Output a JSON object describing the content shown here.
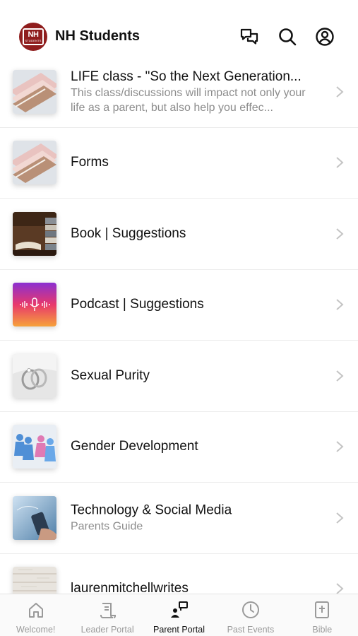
{
  "header": {
    "logo_text": "NH",
    "logo_sub": "STUDENTS",
    "title": "NH Students",
    "icons": [
      "messages-icon",
      "search-icon",
      "account-icon"
    ]
  },
  "items": [
    {
      "title": "LIFE class - \"So the Next Generation...",
      "subtitle": "This class/discussions will impact not only your life as a parent, but also help you effec...",
      "thumb": "notebooks-pink"
    },
    {
      "title": "Forms",
      "subtitle": "",
      "thumb": "notebooks-pink"
    },
    {
      "title": "Book | Suggestions",
      "subtitle": "",
      "thumb": "books-stack"
    },
    {
      "title": "Podcast | Suggestions",
      "subtitle": "",
      "thumb": "podcast-gradient"
    },
    {
      "title": "Sexual Purity",
      "subtitle": "",
      "thumb": "wedding-rings"
    },
    {
      "title": "Gender Development",
      "subtitle": "",
      "thumb": "figures-blue-pink"
    },
    {
      "title": "Technology & Social Media",
      "subtitle": "Parents Guide",
      "thumb": "phone-hand"
    },
    {
      "title": "laurenmitchellwrites",
      "subtitle": "",
      "thumb": "wood-planks"
    }
  ],
  "tabs": [
    {
      "label": "Welcome!",
      "icon": "home-icon",
      "active": false
    },
    {
      "label": "Leader Portal",
      "icon": "scroll-icon",
      "active": false
    },
    {
      "label": "Parent Portal",
      "icon": "parent-portal-icon",
      "active": true
    },
    {
      "label": "Past Events",
      "icon": "clock-icon",
      "active": false
    },
    {
      "label": "Bible",
      "icon": "bible-icon",
      "active": false
    }
  ],
  "colors": {
    "brand": "#8f1d1d",
    "text": "#111111",
    "muted": "#8c8c8c",
    "tab_inactive": "#9a9a9a"
  }
}
